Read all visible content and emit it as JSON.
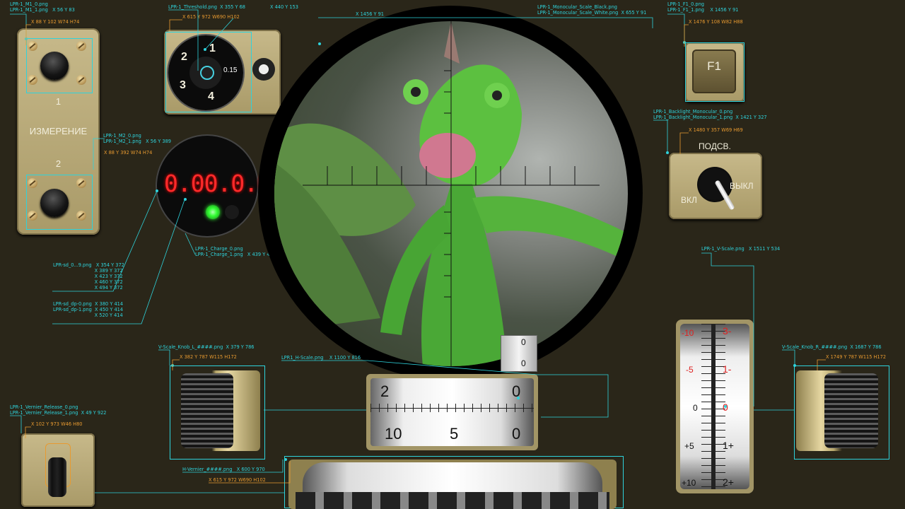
{
  "colors": {
    "background": "#2a2619",
    "annotation_cyan": "#2ed3dc",
    "annotation_orange": "#e89a30",
    "panel": "#b8aa78",
    "lcd_red": "#ff2a2a",
    "led_green": "#33ff33"
  },
  "annotations": {
    "m1": {
      "name": "LPR-1_M1_0.png\nLPR-1_M1_1.png   X 56 Y 83",
      "geom": "X 88 Y 102 W74 H74"
    },
    "m2": {
      "name": "LPR-1_M2_0.png\nLPR-1_M2_1.png   X 56 Y 389",
      "geom": "X 88 Y 392 W74 H74"
    },
    "threshold": {
      "name": "LPR-1_Threshold.png  X 355 Y 68",
      "geom": "X 615 Y 972 W690 H102",
      "extra": "X 440 Y 153"
    },
    "monocular_scale": {
      "name": "LPR-1_Monocular_Scale_Black.png\nLPR-1_Monocular_Scale_White.png  X 655 Y 91",
      "extra": "X 1456 Y 91"
    },
    "f1": {
      "name": "LPR-1_F1_0.png\nLPR-1_F1_1.png    X 1456 Y 91",
      "geom": "X 1476 Y 108 W82 H88"
    },
    "backlight": {
      "name": "LPR-1_Backlight_Monocular_0.png\nLPR-1_Backlight_Monocular_1.png  X 1421 Y 327",
      "geom": "X 1480 Y 357 W69 H69"
    },
    "segdisp": {
      "digits": "LPR-sd_0...9.png   X 354 Y 372\n                            X 389 Y 372\n                            X 423 Y 372\n                            X 460 Y 372\n                            X 494 Y 372",
      "dp": "LPR-sd_dp-0.png  X 380 Y 414\nLPR-sd_dp-1.png  X 450 Y 414\n                            X 520 Y 414"
    },
    "charge": {
      "name": "LPR-1_Charge_0.png\nLPR-1_Charge_1.png   X 439 Y 435"
    },
    "v_scale": {
      "name": "LPR-1_V-Scale.png   X 1511 Y 534"
    },
    "h_scale": {
      "name": "LPR1_H-Scale.png    X 1100 Y 816"
    },
    "knob_l": {
      "name": "V-Scale_Knob_L_####.png  X 379 Y 786",
      "geom": "X 382 Y 787 W115 H172"
    },
    "knob_r": {
      "name": "V-Scale_Knob_R_####.png  X 1687 Y 786",
      "geom": "X 1749 Y 787 W115 H172"
    },
    "vernier_release": {
      "name": "LPR-1_Vernier_Release_0.png\nLPR-1_Vernier_Release_1.png  X 49 Y 922",
      "geom": "X 102 Y 973 W46 H80"
    },
    "h_vernier": {
      "name": "H-Vernier_####.png   X 600 Y 970",
      "geom": "X 615 Y 972 W690 H102"
    }
  },
  "panel_left": {
    "label_1": "1",
    "label_measure": "ИЗМЕРЕНИЕ",
    "label_2": "2"
  },
  "threshold_dial": {
    "marks": [
      "1",
      "2",
      "3",
      "4"
    ],
    "value": "0.15"
  },
  "display": {
    "value": "0.00.0.0.",
    "led_on": true
  },
  "f1_button": {
    "label": "F1"
  },
  "backlight": {
    "title": "ПОДСВ.",
    "off": "ВЫКЛ",
    "on": "ВКЛ"
  },
  "small_counter": {
    "top": "0",
    "bottom": "0"
  },
  "h_scale": {
    "top": [
      "2",
      "0"
    ],
    "bottom": [
      "10",
      "5",
      "0"
    ]
  },
  "v_scale": {
    "left": [
      "-10",
      "-5",
      "0",
      "+5",
      "+10"
    ],
    "right": [
      "3-",
      "1-",
      "0",
      "1+",
      "2+"
    ]
  }
}
